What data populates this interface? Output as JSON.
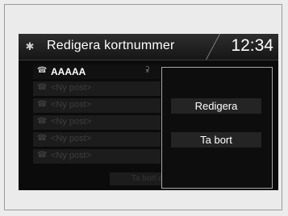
{
  "header": {
    "title": "Redigera kortnummer",
    "clock": "12:34"
  },
  "list": {
    "rows": [
      {
        "label": "AAAAA",
        "active": true,
        "voice_tag": "⫂"
      },
      {
        "label": "<Ny post>",
        "active": false
      },
      {
        "label": "<Ny post>",
        "active": false
      },
      {
        "label": "<Ny post>",
        "active": false
      },
      {
        "label": "<Ny post>",
        "active": false
      },
      {
        "label": "<Ny post>",
        "active": false
      }
    ],
    "delete_all_label": "Ta bort all"
  },
  "popup": {
    "edit_label": "Redigera",
    "delete_label": "Ta bort"
  },
  "icons": {
    "settings": "gear-icon",
    "phone": "phone-icon",
    "voice": "voice-tag-icon"
  }
}
